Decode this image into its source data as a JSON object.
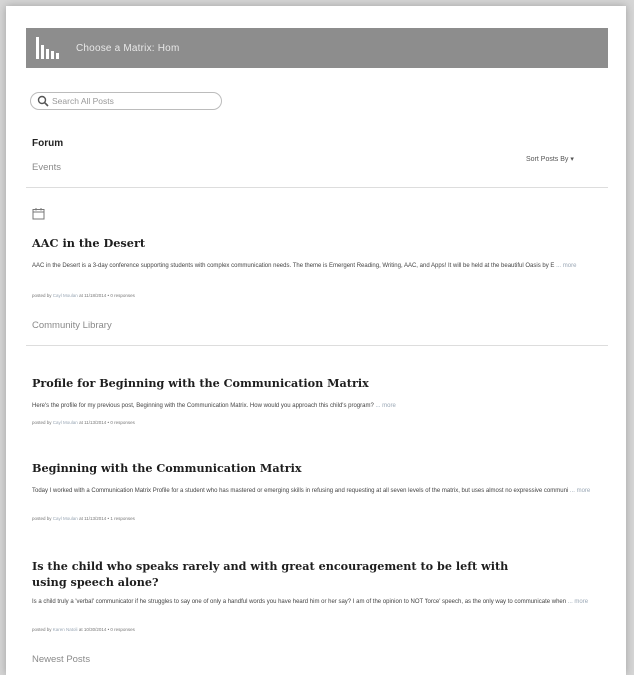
{
  "header": {
    "title": "Choose a Matrix: Hom"
  },
  "search": {
    "placeholder": "Search All Posts"
  },
  "nav": {
    "forum": "Forum",
    "events": "Events"
  },
  "sort": {
    "label": "Sort Posts By ▾"
  },
  "event_post": {
    "title": "AAC in the Desert",
    "body": "AAC in the Desert is a 3-day conference supporting students with complex communication needs. The theme is Emergent Reading, Writing, AAC, and Apps! It will be held at the beautiful Oasis by E",
    "more": "... more",
    "meta_prefix": "posted by",
    "author": "Cayl Moulan",
    "meta_suffix": "at 11/18/2014 • 0 responses"
  },
  "sections": {
    "library": "Community Library",
    "newest": "Newest Posts"
  },
  "posts": [
    {
      "title": "Profile for Beginning with the Communication Matrix",
      "body": "Here's the profile for my previous post, Beginning with the Communication Matrix.  How would you approach this child's program?",
      "more": "... more",
      "meta_prefix": "posted by",
      "author": "Cayl Moulan",
      "meta_suffix": "at 11/13/2014 • 0 responses"
    },
    {
      "title": "Beginning with the Communication Matrix",
      "body": "Today I worked with a Communication Matrix Profile for a student who has mastered or emerging skills in refusing and requesting at all seven levels of the matrix, but uses almost no expressive communi",
      "more": "... more",
      "meta_prefix": "posted by",
      "author": "Cayl Moulan",
      "meta_suffix": "at 11/13/2014 • 1 responses"
    },
    {
      "title": "Is the child who speaks rarely and with great encouragement to be left with using speech alone?",
      "body": "Is a child truly a 'verbal' communicator if he struggles to say one of only a handful words you have heard him or her say? I am of the opinion to NOT 'force' speech, as the only way to communicate when",
      "more": "... more",
      "meta_prefix": "posted by",
      "author": "Karen Natoli",
      "meta_suffix": "at 10/30/2014 • 0 responses"
    }
  ]
}
